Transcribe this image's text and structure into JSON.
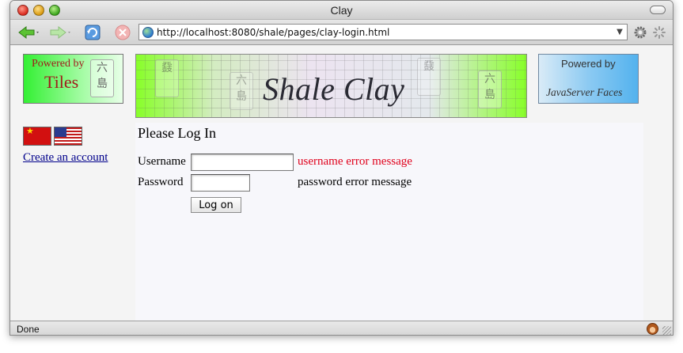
{
  "window": {
    "title": "Clay"
  },
  "toolbar": {
    "url": "http://localhost:8080/shale/pages/clay-login.html"
  },
  "logos": {
    "tiles_powered": "Powered by",
    "tiles_name": "Tiles",
    "banner_title": "Shale Clay",
    "jsf_powered": "Powered by",
    "jsf_name": "JavaServer Faces"
  },
  "sidebar": {
    "create_account": "Create an account"
  },
  "login": {
    "title": "Please Log In",
    "username_label": "Username",
    "username_value": "",
    "username_error": "username error message",
    "password_label": "Password",
    "password_value": "",
    "password_error": "password error message",
    "logon_button": "Log on"
  },
  "status": {
    "text": "Done"
  },
  "colors": {
    "error_red": "#e0001b",
    "link_blue": "#00008b"
  }
}
